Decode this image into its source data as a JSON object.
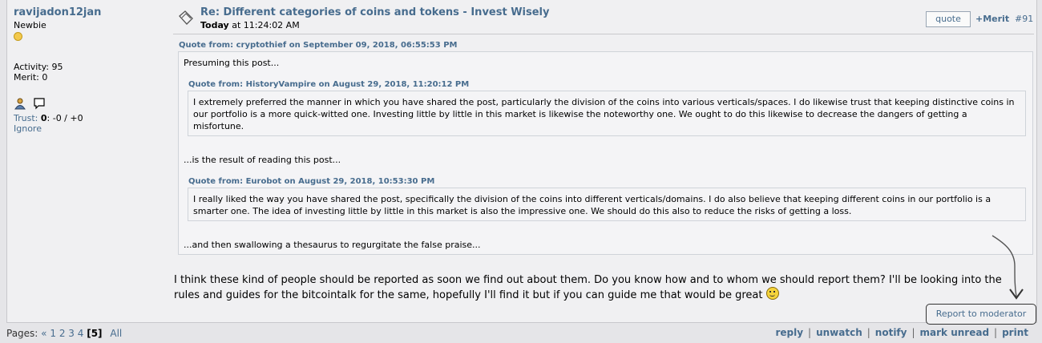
{
  "poster": {
    "name": "ravijadon12jan",
    "rank": "Newbie",
    "activity": "Activity: 95",
    "merit": "Merit: 0",
    "trust_label": "Trust:",
    "trust_value": "0",
    "trust_detail": ": -0 / +0",
    "ignore": "Ignore"
  },
  "post": {
    "subject": "Re: Different categories of coins and tokens - Invest Wisely",
    "date_today": "Today",
    "date_time": " at 11:24:02 AM",
    "quote_button": "quote",
    "merit_link": "+Merit",
    "post_number": "#91"
  },
  "quote_outer": {
    "header": "Quote from: cryptothief on September 09, 2018, 06:55:53 PM",
    "line1": "Presuming this post...",
    "line2": "...is the result of reading this post...",
    "line3": "...and then swallowing a thesaurus to regurgitate the false praise..."
  },
  "quote_inner1": {
    "header": "Quote from: HistoryVampire on August 29, 2018, 11:20:12 PM",
    "text": "I extremely preferred the manner in which you have shared the post, particularly the division of the coins into various verticals/spaces. I do likewise trust that keeping distinctive coins in our portfolio is a more quick-witted one. Investing little by little in this market is likewise the noteworthy one. We ought to do this likewise to decrease the dangers of getting a misfortune."
  },
  "quote_inner2": {
    "header": "Quote from: Eurobot on August 29, 2018, 10:53:30 PM",
    "text": "I really liked the way you have shared the post, specifically the division of the coins into different verticals/domains. I do also believe that keeping different coins in our portfolio is a smarter one. The idea of investing little by little in this market is also the impressive one. We should do this also to reduce the risks of getting a loss."
  },
  "body_text": "I think these kind of people should be reported as soon we find out about them. Do you know how and to whom we should report them? I'll be looking into the rules and guides for the bitcointalk for the same, hopefully I'll find it but if you can guide me that would be great ",
  "report": "Report to moderator",
  "pagination": {
    "label": "Pages: ",
    "prev": "«",
    "pages": [
      "1",
      "2",
      "3",
      "4"
    ],
    "current": "[5]",
    "all": "All"
  },
  "actions": [
    "reply",
    "unwatch",
    "notify",
    "mark unread",
    "print"
  ],
  "icons": [
    "profile-icon",
    "message-icon",
    "subject-icon",
    "smiley-icon",
    "rank-coin-icon"
  ],
  "colors": {
    "link": "#476c8e",
    "background": "#f0f0f2",
    "quote_bg": "#f4f4f6"
  }
}
